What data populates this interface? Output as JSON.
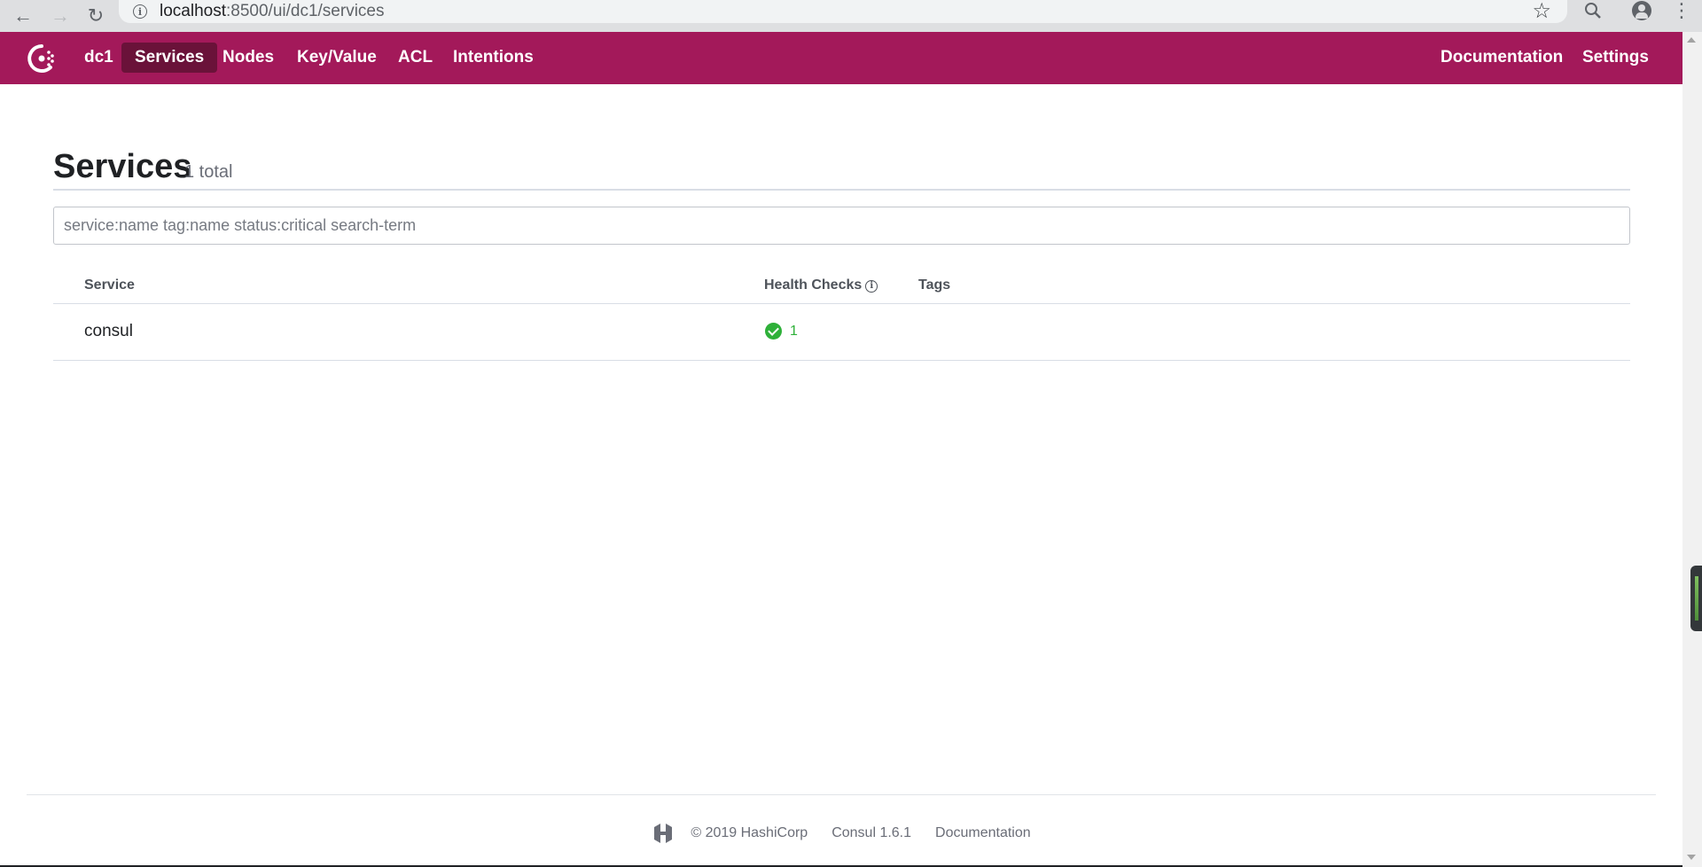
{
  "browser": {
    "url_host": "localhost",
    "url_path": ":8500/ui/dc1/services"
  },
  "header": {
    "datacenter": "dc1",
    "nav": {
      "services": "Services",
      "nodes": "Nodes",
      "key_value": "Key/Value",
      "acl": "ACL",
      "intentions": "Intentions",
      "documentation": "Documentation",
      "settings": "Settings"
    },
    "brand_color": "#a3195a",
    "active_color": "#6a1239"
  },
  "page": {
    "title": "Services",
    "count": "1 total"
  },
  "search": {
    "placeholder": "service:name tag:name status:critical search-term",
    "value": ""
  },
  "table": {
    "headers": {
      "service": "Service",
      "health_checks": "Health Checks",
      "tags": "Tags"
    },
    "rows": [
      {
        "service": "consul",
        "health_passing": "1",
        "tags": ""
      }
    ],
    "passing_color": "#2eb039"
  },
  "footer": {
    "copyright": "© 2019 HashiCorp",
    "version": "Consul 1.6.1",
    "documentation": "Documentation"
  }
}
